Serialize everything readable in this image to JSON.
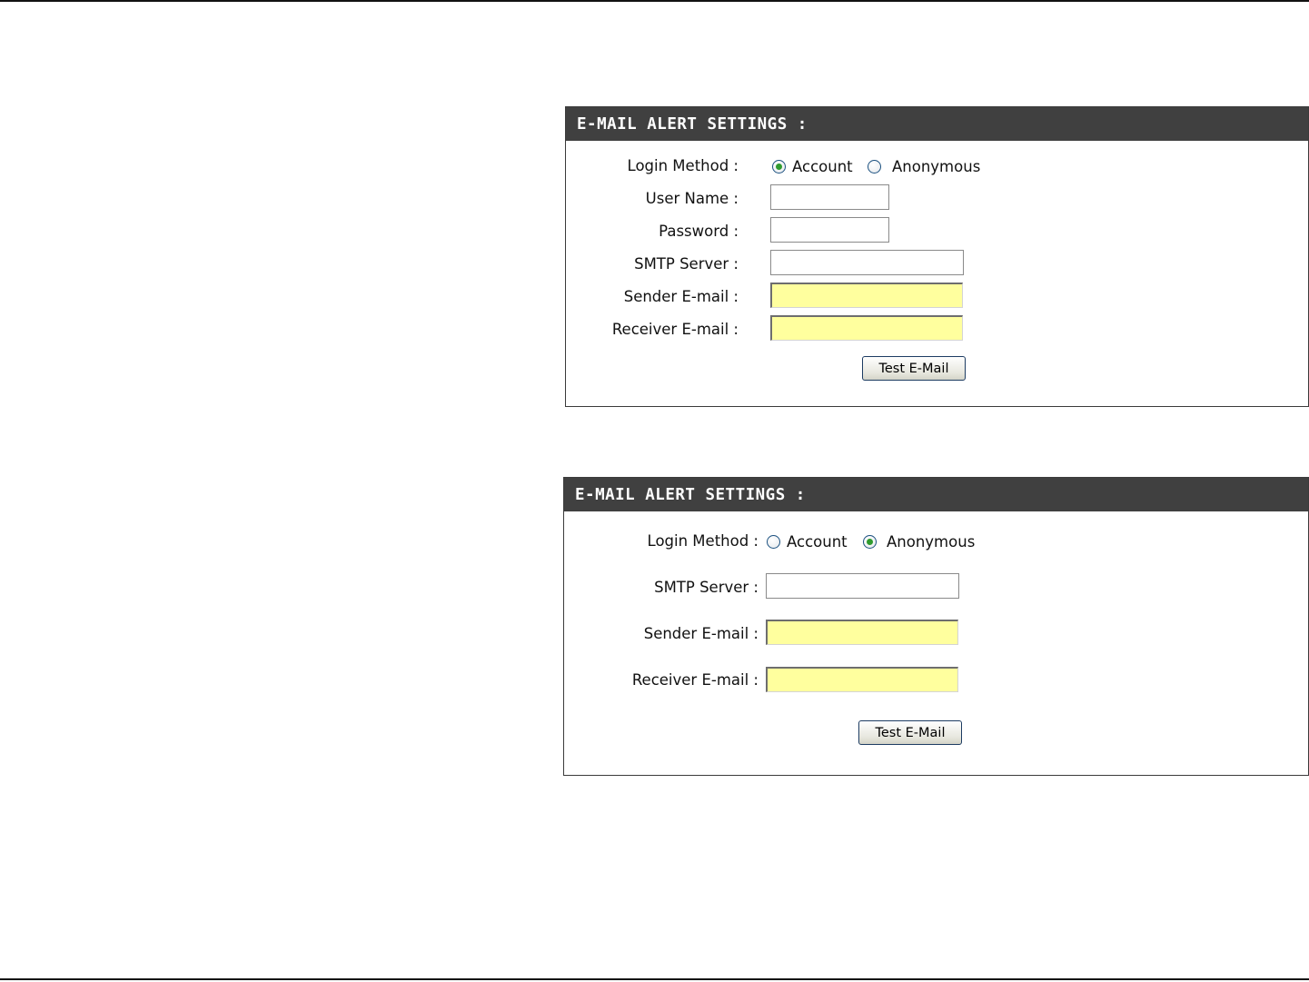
{
  "panels": [
    {
      "title": "E-MAIL ALERT SETTINGS :",
      "login_method_label": "Login Method :",
      "radio_account_label": "Account",
      "radio_anonymous_label": "Anonymous",
      "selected_method": "Account",
      "user_name_label": "User Name :",
      "user_name_value": "",
      "password_label": "Password :",
      "password_value": "",
      "smtp_server_label": "SMTP Server :",
      "smtp_server_value": "",
      "sender_email_label": "Sender E-mail :",
      "sender_email_value": "",
      "receiver_email_label": "Receiver E-mail :",
      "receiver_email_value": "",
      "test_button_label": "Test E-Mail"
    },
    {
      "title": "E-MAIL ALERT SETTINGS :",
      "login_method_label": "Login Method :",
      "radio_account_label": "Account",
      "radio_anonymous_label": "Anonymous",
      "selected_method": "Anonymous",
      "smtp_server_label": "SMTP Server :",
      "smtp_server_value": "",
      "sender_email_label": "Sender E-mail :",
      "sender_email_value": "",
      "receiver_email_label": "Receiver E-mail :",
      "receiver_email_value": "",
      "test_button_label": "Test E-Mail"
    }
  ],
  "colors": {
    "header_bg": "#404040",
    "header_text": "#ffffff",
    "required_field_bg": "#ffff9e",
    "radio_selected_dot": "#2f9b2f"
  }
}
